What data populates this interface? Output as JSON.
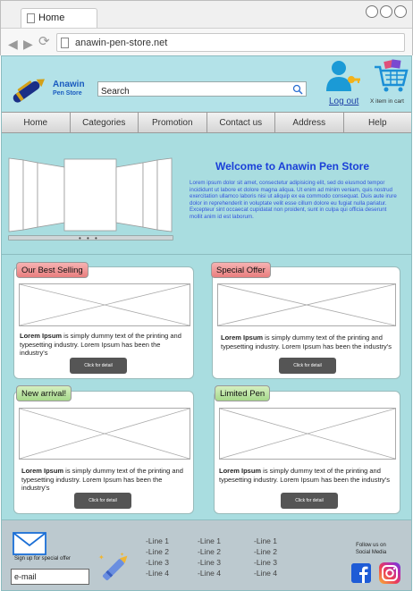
{
  "browser": {
    "tab_title": "Home",
    "url": "anawin-pen-store.net"
  },
  "header": {
    "brand_name": "Anawin",
    "brand_sub": "Pen Store",
    "search_placeholder": "Search",
    "logout_label": "Log out",
    "cart_count_label": "X item in cart"
  },
  "menu": [
    {
      "label": "Home"
    },
    {
      "label": "Categories"
    },
    {
      "label": "Promotion"
    },
    {
      "label": "Contact us"
    },
    {
      "label": "Address"
    },
    {
      "label": "Help"
    }
  ],
  "hero": {
    "welcome": "Welcome to Anawin Pen Store",
    "body": "Lorem ipsum dolor sit amet, consectetur adipisicing elit, sed do eiusmod tempor incididunt ut labore et dolore magna aliqua. Ut enim ad minim veniam, quis nostrud exercitation ullamco laboris nisi ut aliquip ex ea commodo consequat. Duis aute irure dolor in reprehenderit in voluptate velit esse cillum dolore eu fugiat nulla pariatur. Excepteur sint occaecat cupidatat non proident, sunt in culpa qui officia deserunt mollit anim id est laborum.",
    "dots": "• • •"
  },
  "cards": [
    {
      "tag": "Our Best Selling",
      "lead": "Lorem Ipsum",
      "text": " is simply dummy text of the printing and typesetting industry. Lorem Ipsum has been the industry's",
      "button": "Click for detail"
    },
    {
      "tag": "Special Offer",
      "lead": "Lorem Ipsum",
      "text": " is simply dummy text of the printing and typesetting industry. Lorem Ipsum has been the industry's",
      "button": "Click for detail"
    },
    {
      "tag": "New arrival!",
      "lead": "Lorem Ipsum",
      "text": " is simply dummy text of the printing and typesetting industry. Lorem Ipsum has been the industry's",
      "button": "Click for detail"
    },
    {
      "tag": "Limited Pen",
      "lead": "Lorem Ipsum",
      "text": " is simply dummy text of the printing and typesetting industry. Lorem Ipsum has been the industry's",
      "button": "Click for detail"
    }
  ],
  "footer": {
    "signup_text": "Sign up for special offer",
    "email_value": "e-mail",
    "link_columns": [
      [
        "-Line 1",
        "-Line 2",
        "-Line 3",
        "-Line 4"
      ],
      [
        "-Line 1",
        "-Line 2",
        "-Line 3",
        "-Line 4"
      ],
      [
        "-Line 1",
        "-Line 2",
        "-Line 3",
        "-Line 4"
      ]
    ],
    "social_label": "Follow us on Social Media",
    "icons": [
      "mail-icon",
      "pen-icon",
      "facebook-icon",
      "instagram-icon"
    ]
  },
  "colors": {
    "page_bg": "#a9dde0",
    "header_bg": "#b3e2e8",
    "brand_blue": "#1a5bbf",
    "welcome_blue": "#1a3fd8",
    "tag_red": "#e97e7e",
    "tag_green": "#a6d98b",
    "button_dark": "#555555",
    "footer_bg": "#bcc9cf"
  }
}
